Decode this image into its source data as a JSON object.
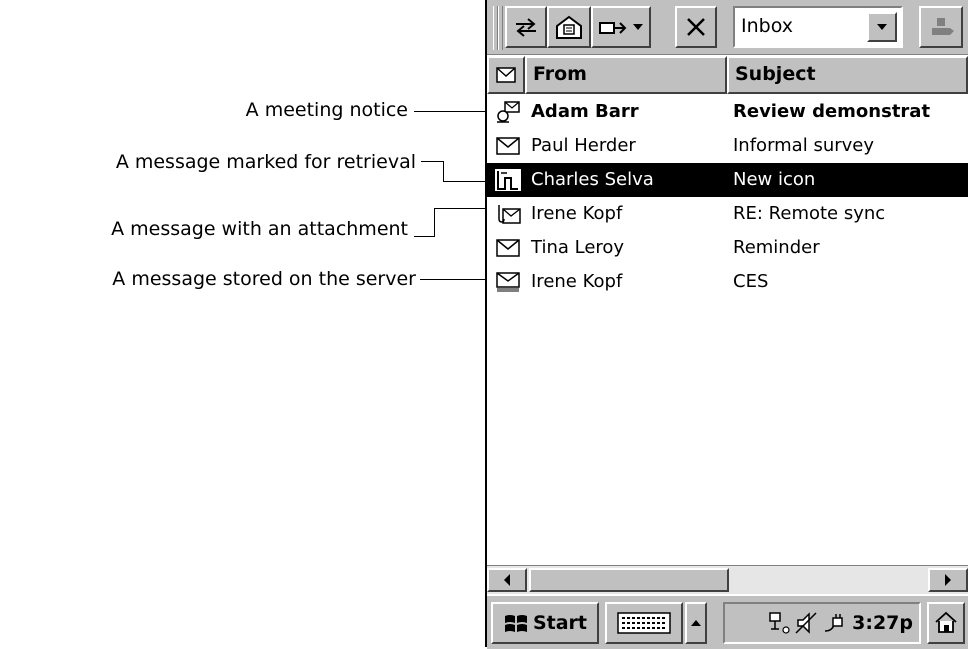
{
  "callouts": [
    {
      "text": "A meeting notice"
    },
    {
      "text": "A message marked for retrieval"
    },
    {
      "text": "A message with an attachment"
    },
    {
      "text": "A message stored on the server"
    }
  ],
  "toolbar": {
    "folder_value": "Inbox",
    "icons": [
      "send-receive-icon",
      "new-message-icon",
      "move-to-icon",
      "delete-icon",
      "back-icon"
    ]
  },
  "columns": {
    "from": "From",
    "subject": "Subject"
  },
  "messages": [
    {
      "from": "Adam Barr",
      "subject": "Review demonstrat",
      "icon": "meeting-notice-icon",
      "bold": true
    },
    {
      "from": "Paul Herder",
      "subject": "Informal survey",
      "icon": "envelope-icon"
    },
    {
      "from": "Charles Selva",
      "subject": "New icon",
      "icon": "marked-for-retrieval-icon",
      "selected": true
    },
    {
      "from": "Irene Kopf",
      "subject": "RE: Remote sync",
      "icon": "attachment-icon"
    },
    {
      "from": "Tina Leroy",
      "subject": "Reminder",
      "icon": "envelope-icon"
    },
    {
      "from": "Irene Kopf",
      "subject": "CES",
      "icon": "server-stored-icon"
    }
  ],
  "taskbar": {
    "start_label": "Start",
    "time": "3:27p"
  },
  "colors": {
    "selection": "#000000",
    "chrome": "#c0c0c0"
  }
}
